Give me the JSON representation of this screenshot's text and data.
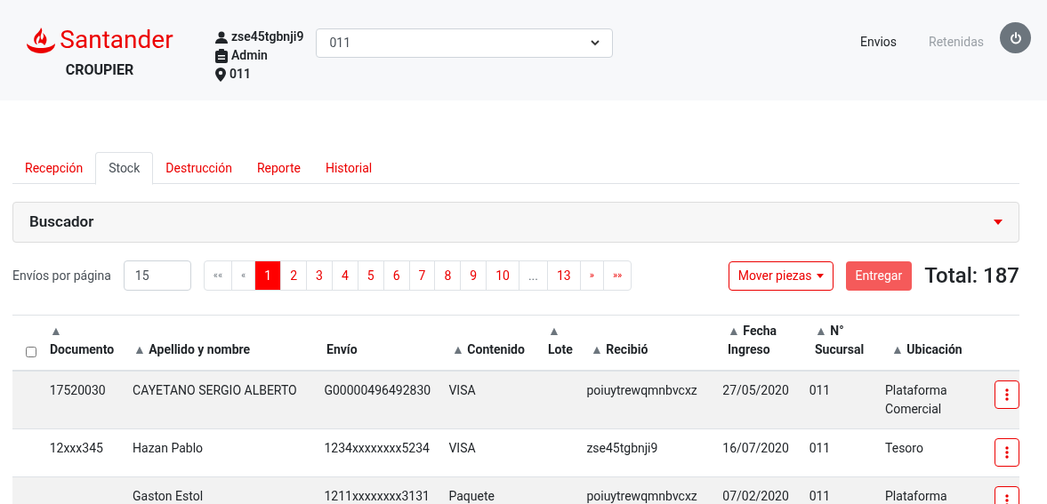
{
  "header": {
    "brand": "Santander",
    "subtitle": "CROUPIER",
    "user": {
      "name": "zse45tgbnji9",
      "role": "Admin",
      "branch": "011"
    },
    "branch_select": {
      "value": "011"
    },
    "nav": [
      {
        "label": "Envios",
        "selected": true
      },
      {
        "label": "Retenidas",
        "selected": false
      }
    ]
  },
  "tabs": [
    {
      "label": "Recepción",
      "selected": false
    },
    {
      "label": "Stock",
      "selected": true
    },
    {
      "label": "Destrucción",
      "selected": false
    },
    {
      "label": "Reporte",
      "selected": false
    },
    {
      "label": "Historial",
      "selected": false
    }
  ],
  "search_panel": {
    "title": "Buscador",
    "expanded": false
  },
  "toolbar": {
    "per_page_label": "Envíos por página",
    "per_page": "15",
    "pagination": {
      "first": "««",
      "prev": "«",
      "next": "»",
      "last": "»»",
      "pages": [
        {
          "label": "1",
          "kind": "page",
          "selected": true
        },
        {
          "label": "2",
          "kind": "page",
          "selected": false
        },
        {
          "label": "3",
          "kind": "page",
          "selected": false
        },
        {
          "label": "4",
          "kind": "page",
          "selected": false
        },
        {
          "label": "5",
          "kind": "page",
          "selected": false
        },
        {
          "label": "6",
          "kind": "page",
          "selected": false
        },
        {
          "label": "7",
          "kind": "page",
          "selected": false
        },
        {
          "label": "8",
          "kind": "page",
          "selected": false
        },
        {
          "label": "9",
          "kind": "page",
          "selected": false
        },
        {
          "label": "10",
          "kind": "page",
          "selected": false
        },
        {
          "label": "...",
          "kind": "gap"
        },
        {
          "label": "13",
          "kind": "page",
          "selected": false
        }
      ]
    },
    "move_button": "Mover piezas",
    "deliver_button": "Entregar",
    "total": "Total: 187"
  },
  "table": {
    "select_all_checked": false,
    "columns": [
      {
        "label": "Documento",
        "arrow": "▲"
      },
      {
        "label": "Apellido y nombre",
        "arrow": "▲"
      },
      {
        "label": "Envío"
      },
      {
        "label": "Contenido",
        "arrow": "▲"
      },
      {
        "label": "Lote",
        "arrow": "▲"
      },
      {
        "label": "Recibió",
        "arrow": "▲"
      },
      {
        "label": "Fecha Ingreso",
        "arrow": "▲"
      },
      {
        "label": "N° Sucursal",
        "arrow": "▲"
      },
      {
        "label": "Ubicación",
        "arrow": "▲"
      }
    ],
    "rows": [
      {
        "cells": [
          "17520030",
          "CAYETANO SERGIO ALBERTO",
          "G00000496492830",
          "VISA",
          "",
          "poiuytrewqmnbvcxz",
          "27/05/2020",
          "011",
          "Plataforma Comercial"
        ]
      },
      {
        "cells": [
          "12xxx345",
          "Hazan Pablo",
          "1234xxxxxxxx5234",
          "VISA",
          "",
          "zse45tgbnji9",
          "16/07/2020",
          "011",
          "Tesoro"
        ]
      },
      {
        "cells": [
          "",
          "Gaston Estol",
          "1211xxxxxxxx3131",
          "Paquete",
          "",
          "poiuytrewqmnbvcxz",
          "07/02/2020",
          "011",
          "Plataforma"
        ]
      }
    ]
  }
}
